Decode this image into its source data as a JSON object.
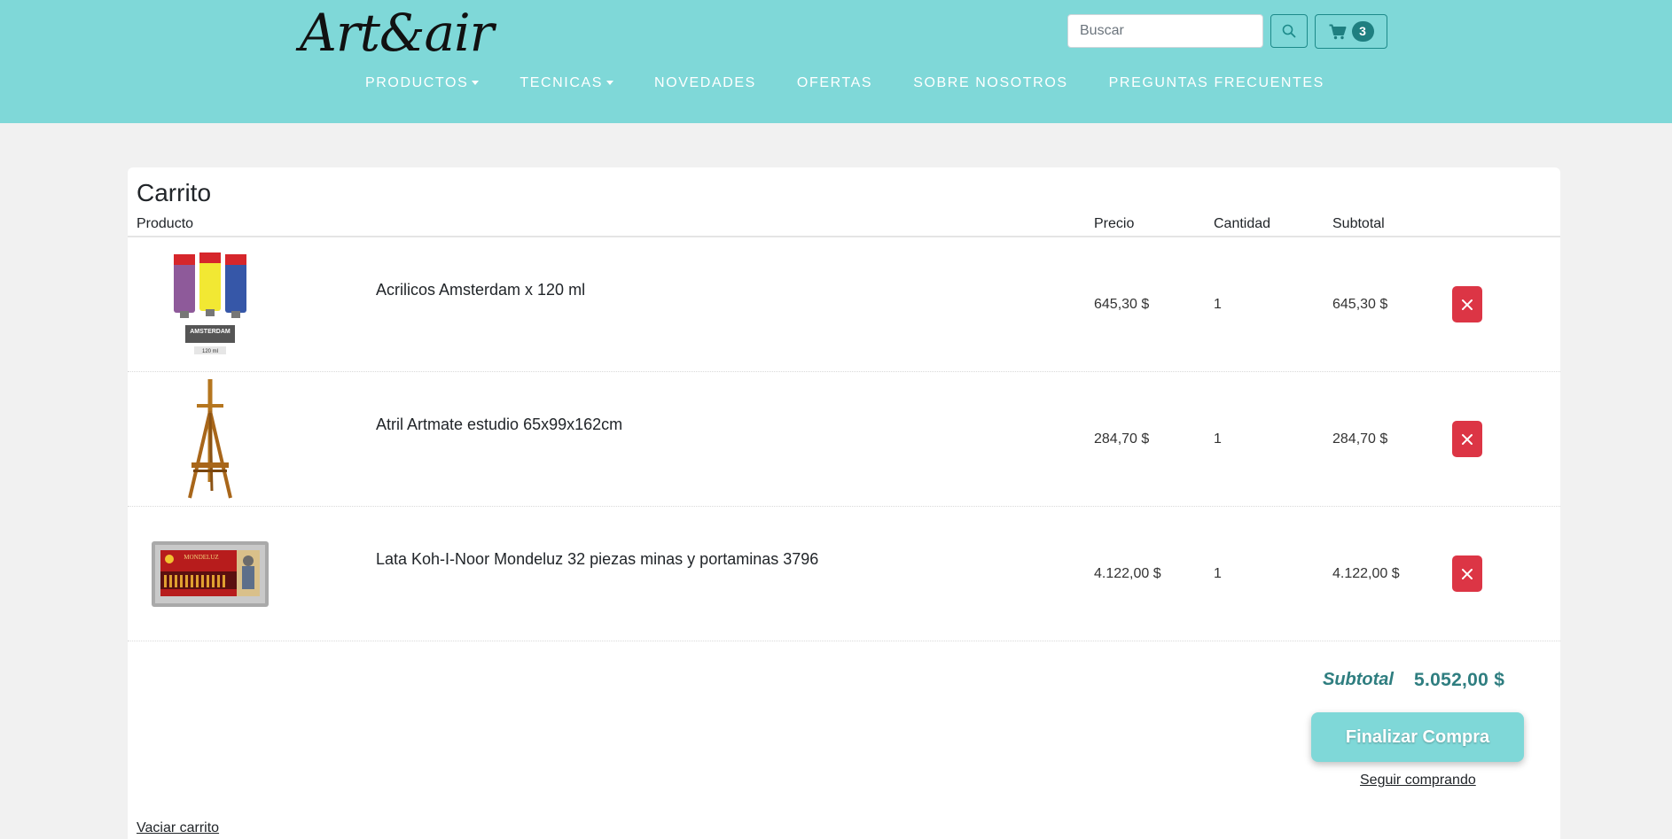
{
  "header": {
    "logo": "Art&air",
    "search": {
      "placeholder": "Buscar"
    },
    "cart_count": "3",
    "nav": [
      {
        "label": "PRODUCTOS",
        "dropdown": true
      },
      {
        "label": "TECNICAS",
        "dropdown": true
      },
      {
        "label": "NOVEDADES",
        "dropdown": false
      },
      {
        "label": "OFERTAS",
        "dropdown": false
      },
      {
        "label": "SOBRE NOSOTROS",
        "dropdown": false
      },
      {
        "label": "PREGUNTAS FRECUENTES",
        "dropdown": false
      }
    ]
  },
  "cart": {
    "title": "Carrito",
    "columns": {
      "product": "Producto",
      "price": "Precio",
      "quantity": "Cantidad",
      "subtotal": "Subtotal"
    },
    "items": [
      {
        "name": "Acrilicos Amsterdam x 120 ml",
        "price": "645,30 $",
        "quantity": "1",
        "subtotal": "645,30 $",
        "image": "paint-tubes",
        "brand_text": "AMSTERDAM",
        "size_text": "120 ml"
      },
      {
        "name": "Atril Artmate estudio 65x99x162cm",
        "price": "284,70 $",
        "quantity": "1",
        "subtotal": "284,70 $",
        "image": "easel"
      },
      {
        "name": "Lata Koh-I-Noor Mondeluz 32 piezas minas y portaminas 3796",
        "price": "4.122,00 $",
        "quantity": "1",
        "subtotal": "4.122,00 $",
        "image": "pencil-tin",
        "brand_text": "MONDELUZ"
      }
    ],
    "total_label": "Subtotal",
    "total_value": "5.052,00 $",
    "checkout_label": "Finalizar Compra",
    "continue_label": "Seguir comprando",
    "empty_label": "Vaciar carrito"
  },
  "colors": {
    "header_bg": "#7fd8d8",
    "accent": "#2f7e80",
    "danger": "#dc3545"
  }
}
